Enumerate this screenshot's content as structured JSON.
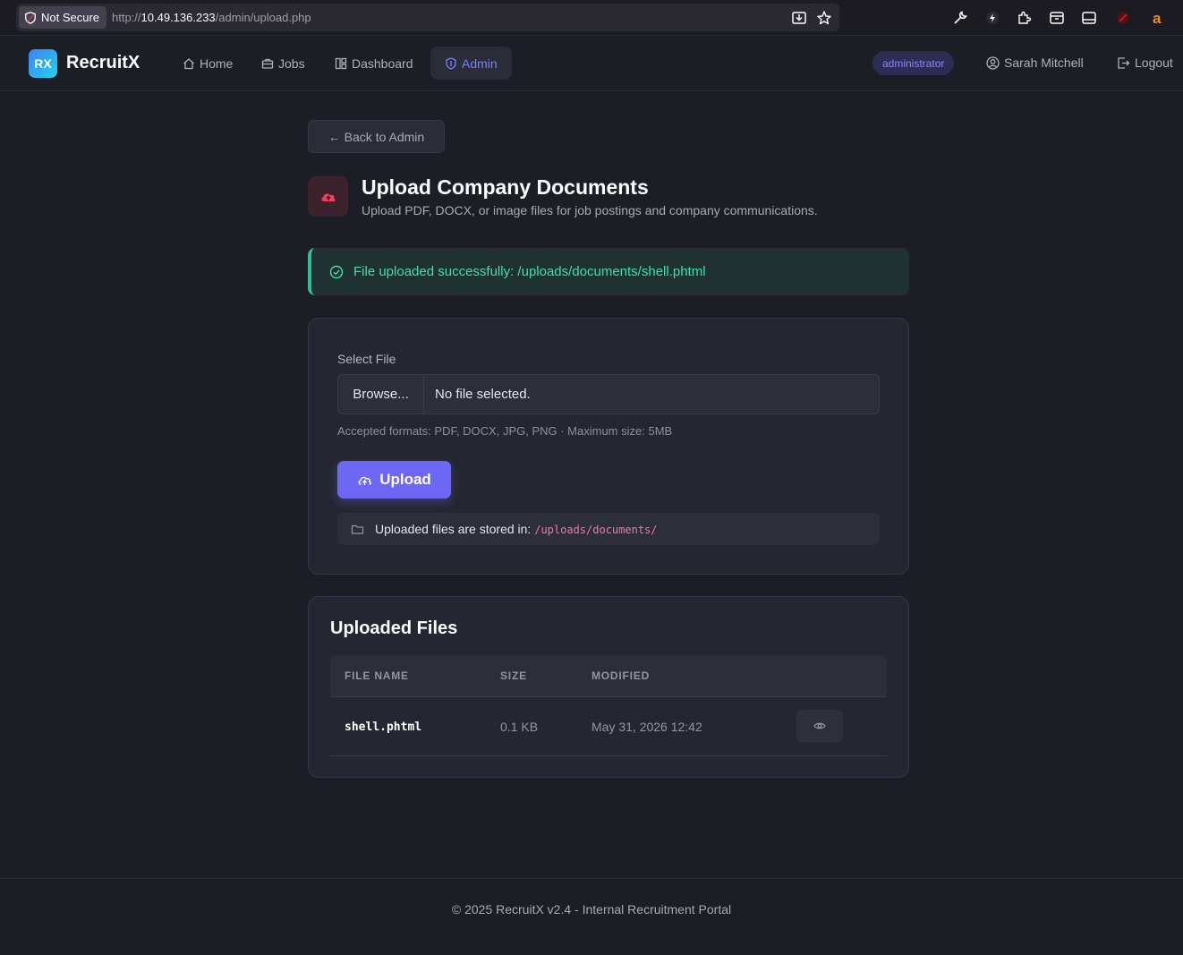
{
  "browser": {
    "security_label": "Not Secure",
    "url_prefix": "http://",
    "url_host": "10.49.136.233",
    "url_path": "/admin/upload.php"
  },
  "nav": {
    "logo_text": "RX",
    "brand": "RecruitX",
    "items": [
      {
        "label": "Home",
        "icon": "home-icon"
      },
      {
        "label": "Jobs",
        "icon": "briefcase-icon"
      },
      {
        "label": "Dashboard",
        "icon": "grid-icon"
      },
      {
        "label": "Admin",
        "icon": "shield-icon",
        "active": true
      }
    ],
    "role_badge": "administrator",
    "user_name": "Sarah Mitchell",
    "logout_label": "Logout"
  },
  "page": {
    "back_label": "← Back to Admin",
    "title": "Upload Company Documents",
    "subtitle": "Upload PDF, DOCX, or image files for job postings and company communications.",
    "alert_text": "File uploaded successfully: /uploads/documents/shell.phtml"
  },
  "upload_form": {
    "select_label": "Select File",
    "browse_label": "Browse...",
    "file_status": "No file selected.",
    "hint": "Accepted formats: PDF, DOCX, JPG, PNG · Maximum size: 5MB",
    "upload_label": "Upload",
    "storage_text": "Uploaded files are stored in:",
    "storage_path": "/uploads/documents/"
  },
  "files_table": {
    "title": "Uploaded Files",
    "columns": [
      "FILE NAME",
      "SIZE",
      "MODIFIED"
    ],
    "rows": [
      {
        "name": "shell.phtml",
        "size": "0.1 KB",
        "modified": "May 31, 2026 12:42"
      }
    ]
  },
  "footer": {
    "text": "© 2025 RecruitX v2.4 - Internal Recruitment Portal"
  },
  "colors": {
    "accent": "#6d67f5",
    "success": "#3ee0a8",
    "background": "#1c1e25",
    "card": "#242731"
  }
}
